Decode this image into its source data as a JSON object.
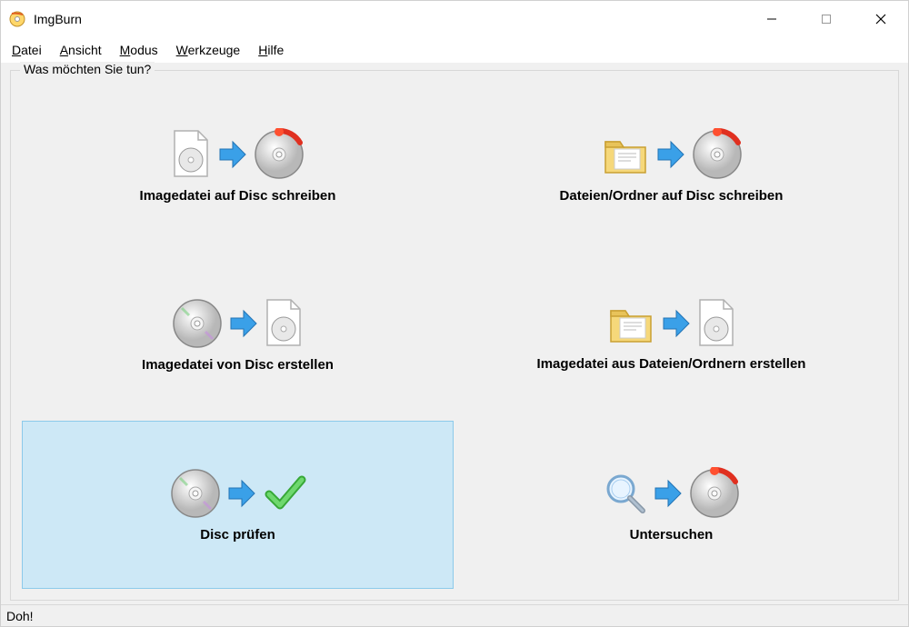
{
  "window": {
    "title": "ImgBurn"
  },
  "menu": {
    "datei": "Datei",
    "ansicht": "Ansicht",
    "modus": "Modus",
    "werkzeuge": "Werkzeuge",
    "hilfe": "Hilfe"
  },
  "groupbox": {
    "title": "Was möchten Sie tun?"
  },
  "options": {
    "write_image_to_disc": "Imagedatei auf Disc schreiben",
    "write_files_to_disc": "Dateien/Ordner auf Disc schreiben",
    "create_image_from_disc": "Imagedatei von Disc erstellen",
    "create_image_from_files": "Imagedatei aus Dateien/Ordnern erstellen",
    "verify_disc": "Disc prüfen",
    "discovery": "Untersuchen"
  },
  "statusbar": {
    "text": "Doh!"
  }
}
